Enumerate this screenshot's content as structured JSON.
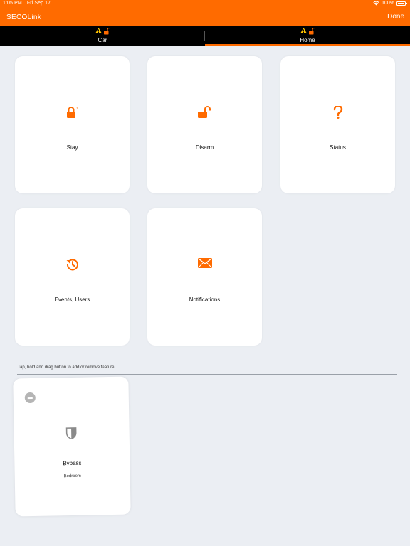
{
  "status_bar": {
    "time": "1:05 PM",
    "date": "Fri Sep 17",
    "battery": "100%"
  },
  "app": {
    "logo": "SECOLink",
    "done_label": "Done",
    "accent_color": "#ff6b00"
  },
  "tabs": [
    {
      "label": "Car",
      "icons": [
        "warning-icon",
        "unlocked-icon"
      ],
      "selected": false
    },
    {
      "label": "Home",
      "icons": [
        "warning-icon",
        "unlocked-icon"
      ],
      "selected": true
    }
  ],
  "features": [
    {
      "label": "Stay",
      "icon": "lock-icon"
    },
    {
      "label": "Disarm",
      "icon": "unlocked-icon"
    },
    {
      "label": "Status",
      "icon": "question-icon"
    },
    {
      "label": "Events, Users",
      "icon": "history-icon"
    },
    {
      "label": "Notifications",
      "icon": "envelope-icon"
    }
  ],
  "hint": "Tap, hold and drag button to add or remove feature",
  "available": [
    {
      "label": "Bypass",
      "sublabel": "Bedroom",
      "icon": "shield-icon"
    }
  ]
}
